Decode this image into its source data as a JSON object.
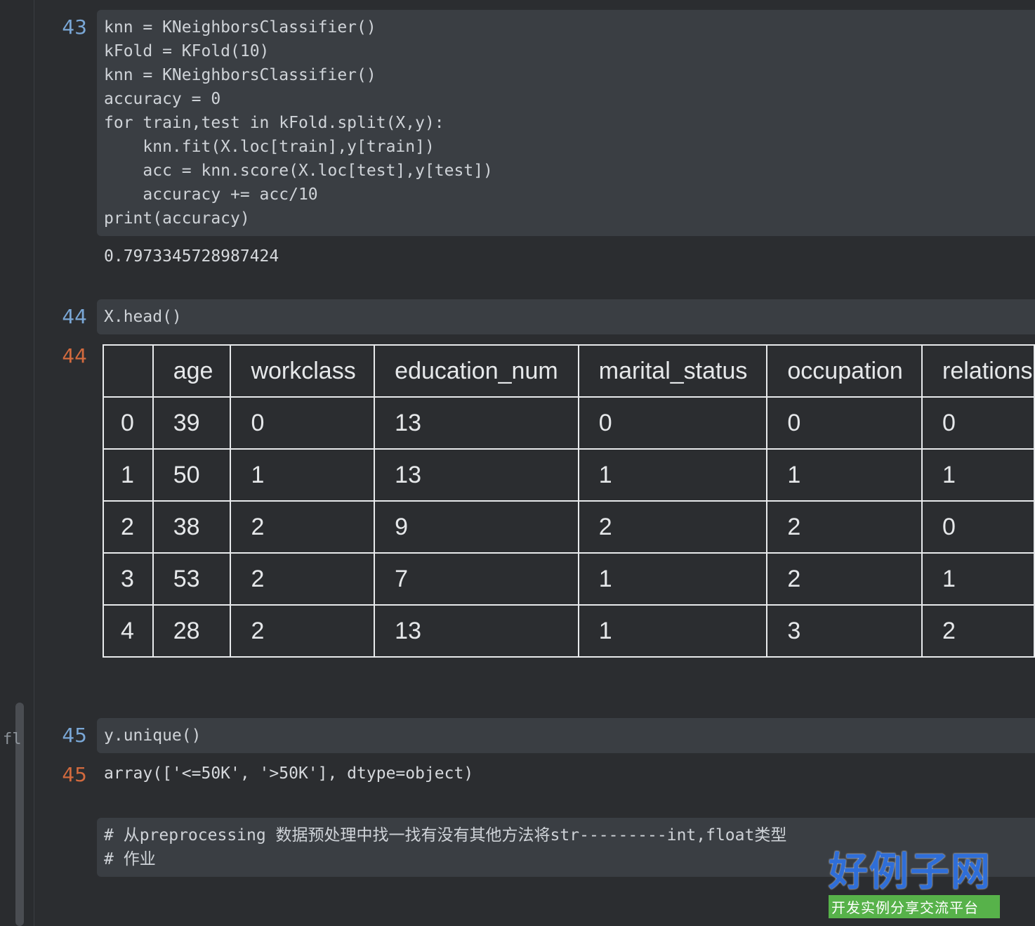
{
  "cells": [
    {
      "in_prompt": "43",
      "code": "knn = KNeighborsClassifier()\nkFold = KFold(10)\nknn = KNeighborsClassifier()\naccuracy = 0\nfor train,test in kFold.split(X,y):\n    knn.fit(X.loc[train],y[train])\n    acc = knn.score(X.loc[test],y[test])\n    accuracy += acc/10\nprint(accuracy)",
      "output": "0.7973345728987424"
    },
    {
      "in_prompt": "44",
      "code": "X.head()",
      "out_prompt": "44"
    },
    {
      "in_prompt": "45",
      "code": "y.unique()",
      "out_prompt": "45",
      "output": "array(['<=50K', '>50K'], dtype=object)"
    },
    {
      "code": "# 从preprocessing 数据预处理中找一找有没有其他方法将str---------int,float类型\n# 作业"
    }
  ],
  "dataframe": {
    "columns": [
      "",
      "age",
      "workclass",
      "education_num",
      "marital_status",
      "occupation",
      "relations"
    ],
    "rows": [
      [
        "0",
        "39",
        "0",
        "13",
        "0",
        "0",
        "0"
      ],
      [
        "1",
        "50",
        "1",
        "13",
        "1",
        "1",
        "1"
      ],
      [
        "2",
        "38",
        "2",
        "9",
        "2",
        "2",
        "0"
      ],
      [
        "3",
        "53",
        "2",
        "7",
        "1",
        "2",
        "1"
      ],
      [
        "4",
        "28",
        "2",
        "13",
        "1",
        "3",
        "2"
      ]
    ]
  },
  "gutter_fragment": "fl",
  "watermark": {
    "main": "好例子网",
    "sub": "开发实例分享交流平台"
  }
}
